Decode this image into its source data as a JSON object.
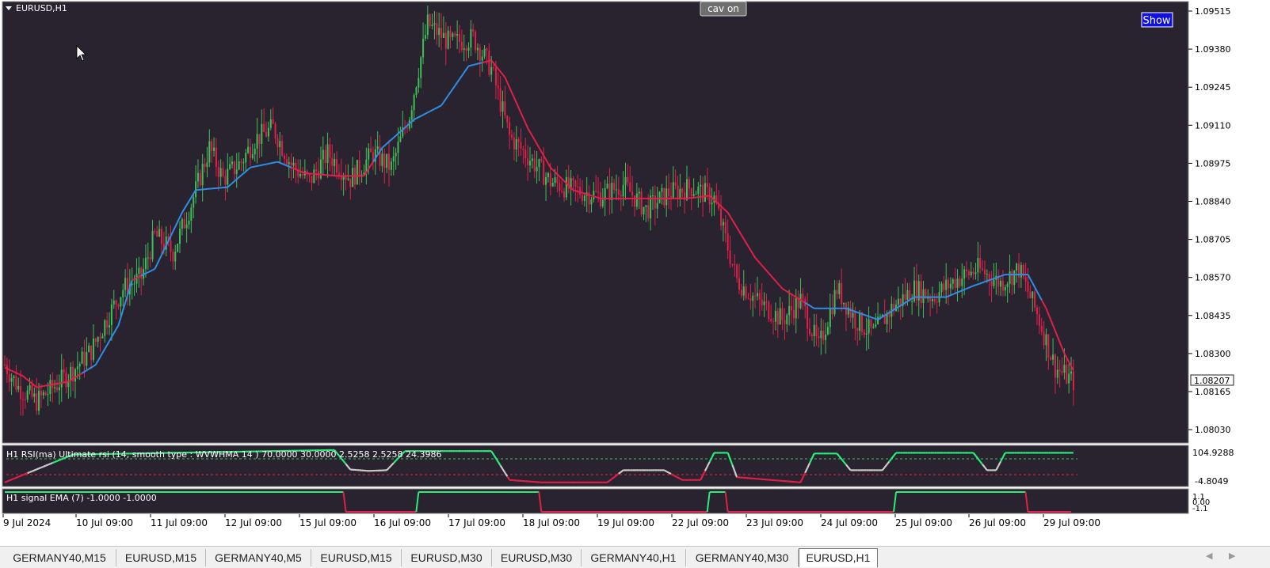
{
  "chart": {
    "symbol_label": "EURUSD,H1",
    "cav_button": "cav on",
    "show_button": "Show",
    "current_price": "1.08207",
    "colors": {
      "background": "#28232e",
      "bull": "#3fbf5a",
      "bear": "#e0204a",
      "ma_up": "#2f8fe8",
      "ma_down": "#e0204a",
      "rsi_high": "#27f07a",
      "rsi_low": "#e0204a",
      "rsi_mid": "#cccccc"
    },
    "indicator1_label": "H1 RSI(ma) Ultimate rsi (14, smooth type : WVWHMA  14 ) 70.0000 30.0000 2.5258 2.5258 24.3986",
    "indicator1_scale": [
      "104.9288",
      "-4.8049"
    ],
    "indicator2_label": "H1 signal EMA (7) -1.0000 -1.0000",
    "indicator2_scale": [
      "1.1",
      "0.00",
      "-1.1"
    ]
  },
  "chart_data": {
    "type": "candlestick",
    "price_axis": [
      "1.09515",
      "1.09380",
      "1.09245",
      "1.09110",
      "1.08975",
      "1.08840",
      "1.08705",
      "1.08570",
      "1.08435",
      "1.08300",
      "1.08165",
      "1.08030"
    ],
    "time_axis": [
      "9 Jul 2024",
      "10 Jul 09:00",
      "11 Jul 09:00",
      "12 Jul 09:00",
      "15 Jul 09:00",
      "16 Jul 09:00",
      "17 Jul 09:00",
      "18 Jul 09:00",
      "19 Jul 09:00",
      "22 Jul 09:00",
      "23 Jul 09:00",
      "24 Jul 09:00",
      "25 Jul 09:00",
      "26 Jul 09:00",
      "29 Jul 09:00"
    ],
    "ylim": [
      1.08,
      1.0956
    ],
    "price_anchors": [
      [
        0,
        1.0826
      ],
      [
        6,
        1.0818
      ],
      [
        14,
        1.0813
      ],
      [
        20,
        1.0817
      ],
      [
        30,
        1.0824
      ],
      [
        38,
        1.0831
      ],
      [
        46,
        1.0844
      ],
      [
        52,
        1.0853
      ],
      [
        60,
        1.0857
      ],
      [
        66,
        1.0872
      ],
      [
        74,
        1.0866
      ],
      [
        82,
        1.0883
      ],
      [
        90,
        1.0903
      ],
      [
        96,
        1.0892
      ],
      [
        104,
        1.0898
      ],
      [
        110,
        1.0906
      ],
      [
        118,
        1.091
      ],
      [
        126,
        1.0897
      ],
      [
        134,
        1.0891
      ],
      [
        142,
        1.0901
      ],
      [
        152,
        1.0892
      ],
      [
        162,
        1.0901
      ],
      [
        170,
        1.0896
      ],
      [
        178,
        1.0915
      ],
      [
        186,
        1.0947
      ],
      [
        196,
        1.094
      ],
      [
        206,
        1.0942
      ],
      [
        214,
        1.0931
      ],
      [
        222,
        1.0907
      ],
      [
        230,
        1.09
      ],
      [
        240,
        1.0891
      ],
      [
        250,
        1.0888
      ],
      [
        262,
        1.0886
      ],
      [
        272,
        1.089
      ],
      [
        282,
        1.0881
      ],
      [
        292,
        1.0887
      ],
      [
        302,
        1.0889
      ],
      [
        312,
        1.0885
      ],
      [
        322,
        1.0856
      ],
      [
        332,
        1.0848
      ],
      [
        342,
        1.0842
      ],
      [
        350,
        1.0849
      ],
      [
        358,
        1.0832
      ],
      [
        366,
        1.0853
      ],
      [
        374,
        1.0842
      ],
      [
        382,
        1.0837
      ],
      [
        390,
        1.0846
      ],
      [
        400,
        1.0853
      ],
      [
        408,
        1.085
      ],
      [
        418,
        1.0856
      ],
      [
        428,
        1.086
      ],
      [
        438,
        1.0855
      ],
      [
        446,
        1.086
      ],
      [
        454,
        1.0844
      ],
      [
        462,
        1.0825
      ],
      [
        470,
        1.082
      ]
    ],
    "ma_anchors": [
      [
        0,
        1.0825
      ],
      [
        8,
        1.0822
      ],
      [
        14,
        1.0818
      ],
      [
        28,
        1.082
      ],
      [
        40,
        1.0826
      ],
      [
        50,
        1.084
      ],
      [
        56,
        1.0856
      ],
      [
        66,
        1.086
      ],
      [
        72,
        1.087
      ],
      [
        78,
        1.088
      ],
      [
        84,
        1.0888
      ],
      [
        98,
        1.0889
      ],
      [
        108,
        1.0896
      ],
      [
        120,
        1.0898
      ],
      [
        132,
        1.0894
      ],
      [
        146,
        1.0893
      ],
      [
        158,
        1.0893
      ],
      [
        166,
        1.0903
      ],
      [
        180,
        1.0913
      ],
      [
        192,
        1.0918
      ],
      [
        204,
        1.0932
      ],
      [
        214,
        1.0934
      ],
      [
        220,
        1.0928
      ],
      [
        230,
        1.091
      ],
      [
        240,
        1.0896
      ],
      [
        250,
        1.0888
      ],
      [
        262,
        1.0885
      ],
      [
        280,
        1.0885
      ],
      [
        300,
        1.0885
      ],
      [
        310,
        1.0886
      ],
      [
        318,
        1.088
      ],
      [
        330,
        1.0864
      ],
      [
        342,
        1.0853
      ],
      [
        356,
        1.0846
      ],
      [
        370,
        1.0846
      ],
      [
        384,
        1.0842
      ],
      [
        390,
        1.0845
      ],
      [
        400,
        1.085
      ],
      [
        414,
        1.085
      ],
      [
        426,
        1.0854
      ],
      [
        440,
        1.0858
      ],
      [
        450,
        1.0858
      ],
      [
        458,
        1.0846
      ],
      [
        466,
        1.083
      ],
      [
        470,
        1.0824
      ]
    ],
    "ma_up_segments": [
      [
        34,
        56
      ],
      [
        60,
        126
      ],
      [
        162,
        210
      ],
      [
        352,
        456
      ]
    ],
    "rsi_plateaus": [
      [
        0,
        5
      ],
      [
        30,
        85
      ],
      [
        145,
        98
      ],
      [
        152,
        42
      ],
      [
        160,
        38
      ],
      [
        168,
        40
      ],
      [
        176,
        95
      ],
      [
        214,
        95
      ],
      [
        222,
        12
      ],
      [
        236,
        5
      ],
      [
        265,
        5
      ],
      [
        272,
        40
      ],
      [
        290,
        40
      ],
      [
        298,
        12
      ],
      [
        306,
        12
      ],
      [
        312,
        90
      ],
      [
        318,
        90
      ],
      [
        322,
        20
      ],
      [
        350,
        5
      ],
      [
        356,
        88
      ],
      [
        366,
        88
      ],
      [
        372,
        40
      ],
      [
        386,
        40
      ],
      [
        392,
        90
      ],
      [
        406,
        90
      ],
      [
        426,
        90
      ],
      [
        432,
        40
      ],
      [
        436,
        40
      ],
      [
        440,
        90
      ],
      [
        470,
        90
      ]
    ],
    "signal_states": [
      [
        0,
        1
      ],
      [
        150,
        -1
      ],
      [
        182,
        1
      ],
      [
        236,
        -1
      ],
      [
        310,
        1
      ],
      [
        318,
        -1
      ],
      [
        392,
        1
      ],
      [
        450,
        -1
      ],
      [
        470,
        -1
      ]
    ]
  },
  "tabs": [
    "GERMANY40,M15",
    "EURUSD,M15",
    "GERMANY40,M5",
    "EURUSD,M15",
    "EURUSD,M30",
    "EURUSD,M30",
    "GERMANY40,H1",
    "GERMANY40,M30",
    "EURUSD,H1"
  ],
  "active_tab_index": 8
}
